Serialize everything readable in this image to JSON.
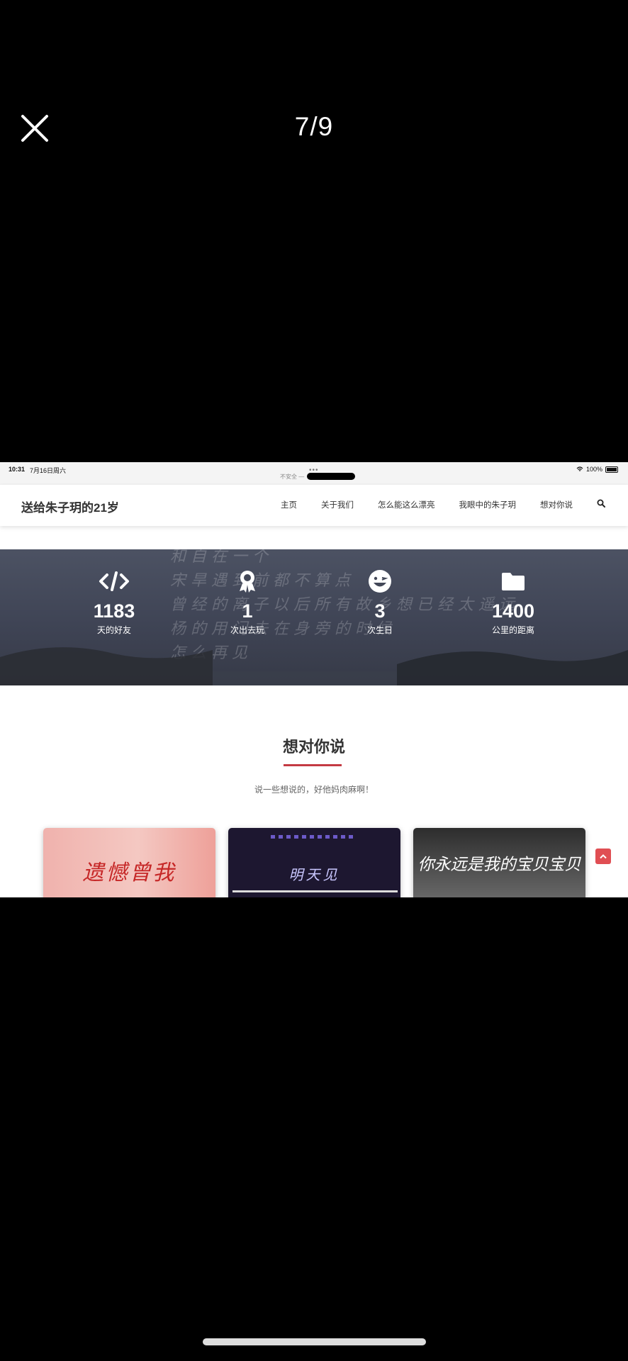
{
  "viewer": {
    "counter": "7/9"
  },
  "status_bar": {
    "time": "10:31",
    "date": "7月16日周六",
    "battery": "100%",
    "url_prefix": "不安全 —"
  },
  "site": {
    "title": "送给朱子玥的21岁",
    "nav": [
      "主页",
      "关于我们",
      "怎么能这么漂亮",
      "我眼中的朱子玥",
      "想对你说"
    ]
  },
  "banner": {
    "background_text": "和 自 在 一 个\n宋 旱 遇 到 前 都 不 算 点\n曾 经 的 离 子 以 后 所 有 故 乡 想 已 经 太 遥 远\n杨 的 用 门 去 在 身 旁 的 时 候\n怎 么 再 见",
    "stats": [
      {
        "icon": "code-icon",
        "number": "1183",
        "label": "天的好友"
      },
      {
        "icon": "award-icon",
        "number": "1",
        "label": "次出去玩"
      },
      {
        "icon": "grin-icon",
        "number": "3",
        "label": "次生日"
      },
      {
        "icon": "folder-icon",
        "number": "1400",
        "label": "公里的距离"
      }
    ]
  },
  "section": {
    "title": "想对你说",
    "subtitle": "说一些想说的，好他妈肉麻啊！"
  },
  "cards": [
    {
      "caption": "遗憾曾我"
    },
    {
      "caption": "明天见"
    },
    {
      "caption": "你永远是我的宝贝宝贝"
    }
  ],
  "colors": {
    "accent": "#c43a43",
    "banner": "#434858"
  }
}
